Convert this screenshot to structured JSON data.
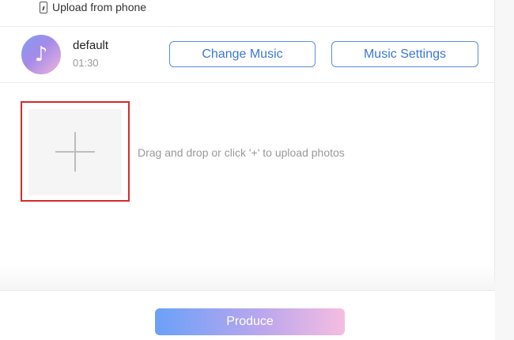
{
  "upload_phone": {
    "label": "Upload from phone",
    "icon": "phone-icon"
  },
  "music": {
    "track_name": "default",
    "duration": "01:30",
    "avatar_icon": "music-note-icon",
    "change_label": "Change Music",
    "settings_label": "Music Settings",
    "accent_color": "#3a78d4"
  },
  "upload": {
    "plus_icon": "plus-icon",
    "hint": "Drag and drop or click '+' to upload photos",
    "highlight_color": "#d42a2a"
  },
  "footer": {
    "produce_label": "Produce"
  }
}
